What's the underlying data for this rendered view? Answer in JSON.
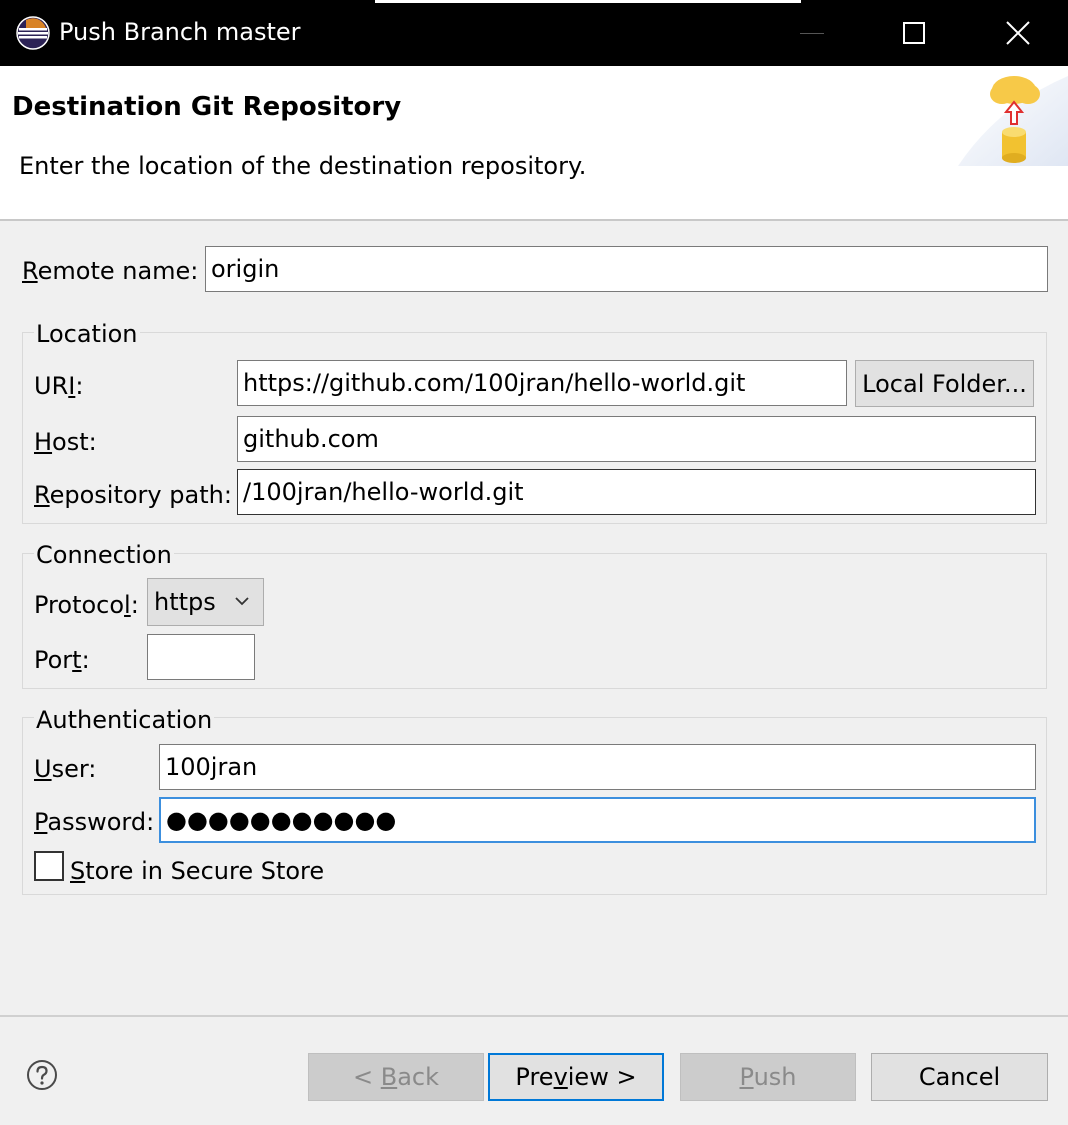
{
  "window": {
    "title": "Push Branch master"
  },
  "header": {
    "title": "Destination Git Repository",
    "description": "Enter the location of the destination repository."
  },
  "remote": {
    "label_mnemonic": "R",
    "label_rest": "emote name:",
    "value": "origin"
  },
  "location": {
    "group_title": "Location",
    "uri_label_pre": "UR",
    "uri_label_mnemonic": "I",
    "uri_label_post": ":",
    "uri_value": "https://github.com/100jran/hello-world.git",
    "local_folder_label": "Local Folder...",
    "host_label_mnemonic": "H",
    "host_label_rest": "ost:",
    "host_value": "github.com",
    "path_label_mnemonic": "R",
    "path_label_rest": "epository path:",
    "path_value": "/100jran/hello-world.git"
  },
  "connection": {
    "group_title": "Connection",
    "protocol_label_pre": "Protoco",
    "protocol_label_mnemonic": "l",
    "protocol_label_post": ":",
    "protocol_value": "https",
    "port_label_pre": "Por",
    "port_label_mnemonic": "t",
    "port_label_post": ":",
    "port_value": ""
  },
  "authentication": {
    "group_title": "Authentication",
    "user_label_mnemonic": "U",
    "user_label_rest": "ser:",
    "user_value": "100jran",
    "password_label_mnemonic": "P",
    "password_label_rest": "assword:",
    "password_value": "●●●●●●●●●●●",
    "store_mnemonic": "S",
    "store_rest": "tore in Secure Store",
    "store_checked": false
  },
  "buttons": {
    "back_pre": "< ",
    "back_mnemonic": "B",
    "back_rest": "ack",
    "preview_pre": "Pre",
    "preview_mnemonic": "v",
    "preview_rest": "iew >",
    "push_mnemonic": "P",
    "push_rest": "ush",
    "cancel": "Cancel"
  },
  "colors": {
    "focus_border": "#3c8fde",
    "default_button_border": "#0078d7"
  },
  "icons": [
    "eclipse-app-icon",
    "minimize-icon",
    "maximize-icon",
    "close-icon",
    "cloud-upload-database-icon",
    "chevron-down-icon",
    "help-icon"
  ]
}
